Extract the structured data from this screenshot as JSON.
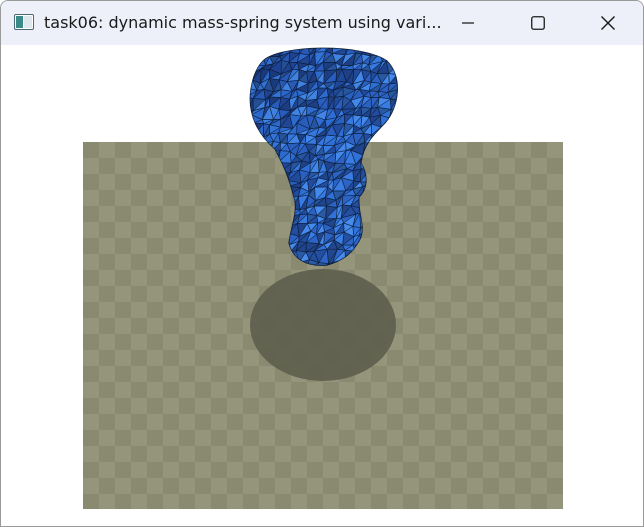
{
  "window": {
    "title": "task06: dynamic mass-spring system using vari...",
    "icon": "app-window-icon",
    "controls": {
      "minimize": "minimize-icon",
      "maximize": "maximize-icon",
      "close": "close-icon"
    }
  },
  "scene": {
    "floor_color": "#95957b",
    "floor_checker_dark": "#8a8a70",
    "shadow_color": "#5a5a4a",
    "mesh_fill": "#2f6fd6",
    "mesh_fill_light": "#4a90f0",
    "mesh_fill_dark": "#1e3f8a",
    "mesh_edge": "#0b1a33"
  }
}
